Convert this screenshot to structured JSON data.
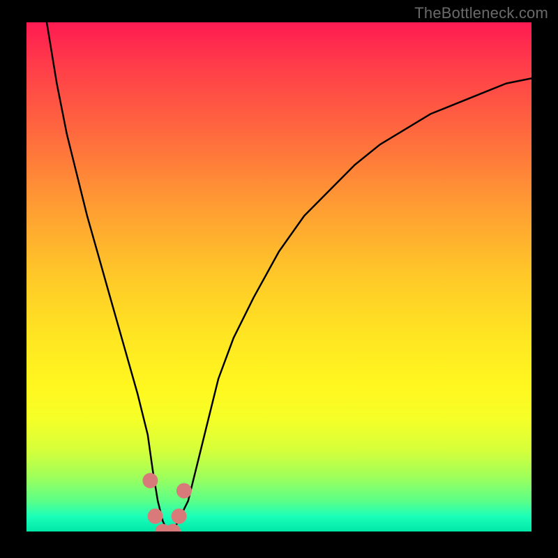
{
  "attribution": "TheBottleneck.com",
  "chart_data": {
    "type": "line",
    "title": "",
    "xlabel": "",
    "ylabel": "",
    "xlim": [
      0,
      100
    ],
    "ylim": [
      0,
      100
    ],
    "grid": false,
    "series": [
      {
        "name": "bottleneck-curve",
        "x": [
          4,
          6,
          8,
          10,
          12,
          14,
          16,
          18,
          20,
          22,
          24,
          25,
          26,
          27,
          28,
          29,
          30,
          32,
          34,
          36,
          38,
          41,
          45,
          50,
          55,
          60,
          65,
          70,
          75,
          80,
          85,
          90,
          95,
          100
        ],
        "values": [
          100,
          88,
          78,
          70,
          62,
          55,
          48,
          41,
          34,
          27,
          19,
          12,
          6,
          2,
          0,
          0,
          2,
          6,
          14,
          22,
          30,
          38,
          46,
          55,
          62,
          67,
          72,
          76,
          79,
          82,
          84,
          86,
          88,
          89
        ]
      }
    ],
    "markers": [
      {
        "name": "marker-a",
        "x": 24.5,
        "y": 10
      },
      {
        "name": "marker-b",
        "x": 25.5,
        "y": 3
      },
      {
        "name": "marker-c",
        "x": 27.0,
        "y": 0
      },
      {
        "name": "marker-d",
        "x": 29.0,
        "y": 0
      },
      {
        "name": "marker-e",
        "x": 30.2,
        "y": 3
      },
      {
        "name": "marker-f",
        "x": 31.2,
        "y": 8
      }
    ],
    "gradient_stops": [
      {
        "pos": 0,
        "color": "#ff1a52"
      },
      {
        "pos": 50,
        "color": "#ffc928"
      },
      {
        "pos": 78,
        "color": "#f5ff28"
      },
      {
        "pos": 100,
        "color": "#00e7a8"
      }
    ]
  },
  "style": {
    "curve_color": "#000000",
    "curve_width": 2.5,
    "marker_color": "#d97a7a",
    "marker_radius": 11
  }
}
